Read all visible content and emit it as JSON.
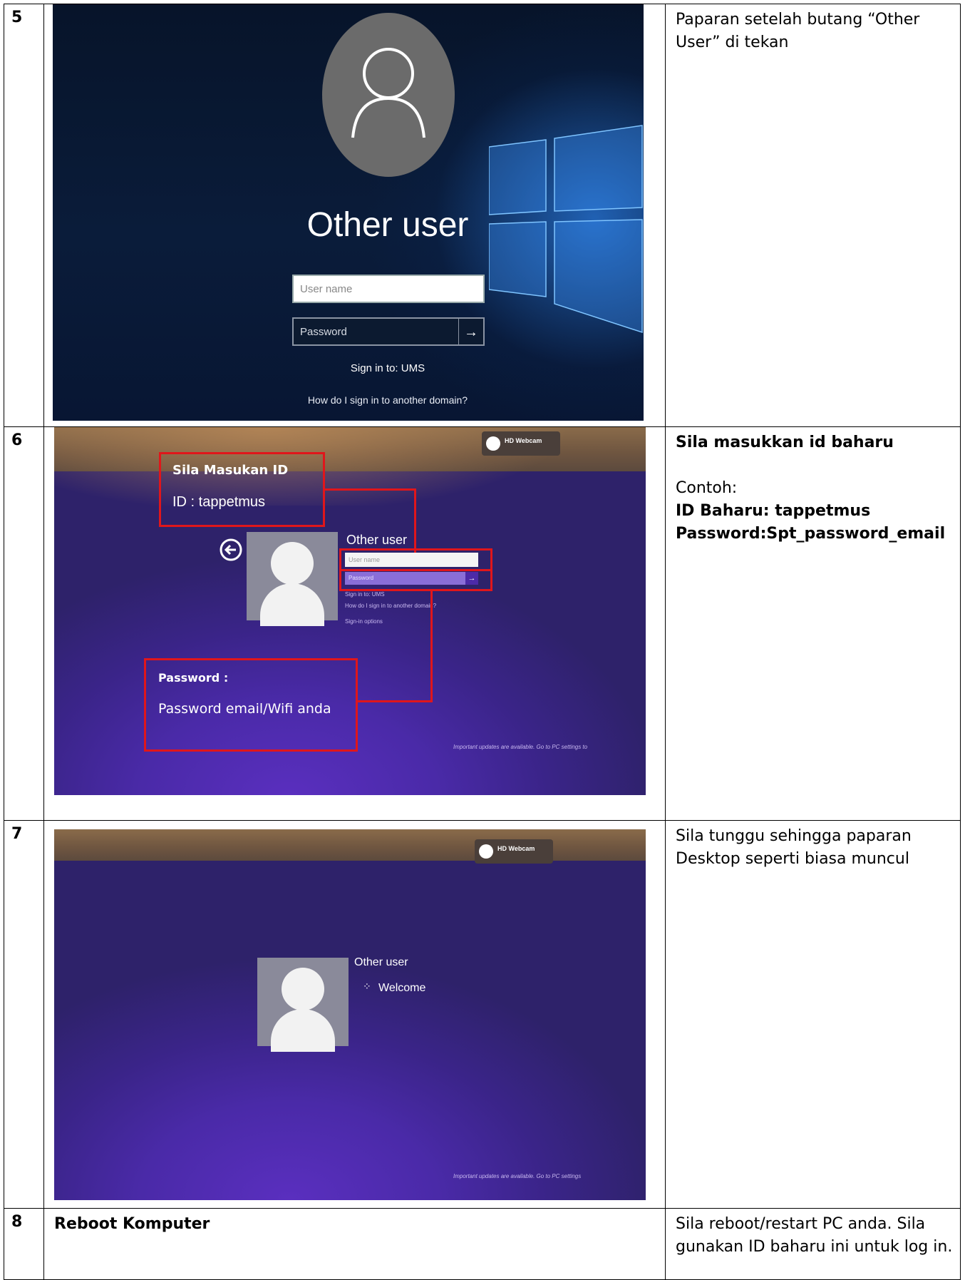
{
  "rows": [
    {
      "num": "5",
      "screen": {
        "title": "Other user",
        "username_placeholder": "User name",
        "password_placeholder": "Password",
        "submit_arrow": "→",
        "sign_in_to": "Sign in to: UMS",
        "domain_link": "How do I sign in to another domain?"
      },
      "desc": "Paparan setelah butang “Other User” di tekan"
    },
    {
      "num": "6",
      "screen": {
        "webcam_label": "HD Webcam",
        "title": "Other user",
        "username_placeholder": "User name",
        "password_placeholder": "Password",
        "submit_arrow": "→",
        "sign_in_to": "Sign in to: UMS",
        "domain_link": "How do I sign in to another domain?",
        "signin_options": "Sign-in options",
        "annot_id_title": "Sila Masukan ID",
        "annot_id_text": "ID : tappetmus",
        "annot_pw_title": "Password :",
        "annot_pw_text": "Password email/Wifi anda",
        "updates_notice": "Important updates are available. Go to PC settings to"
      },
      "desc_title": "Sila masukkan id baharu",
      "desc_example": "Contoh:",
      "desc_id": "ID Baharu: tappetmus",
      "desc_pw": "Password:Spt_password_email"
    },
    {
      "num": "7",
      "screen": {
        "webcam_label": "HD Webcam",
        "title": "Other user",
        "welcome": "Welcome",
        "updates_notice": "Important updates are available. Go to PC settings"
      },
      "desc": "Sila tunggu sehingga paparan Desktop seperti biasa muncul"
    },
    {
      "num": "8",
      "action": "Reboot Komputer",
      "desc": "Sila reboot/restart PC anda. Sila gunakan ID baharu ini untuk log in."
    }
  ]
}
